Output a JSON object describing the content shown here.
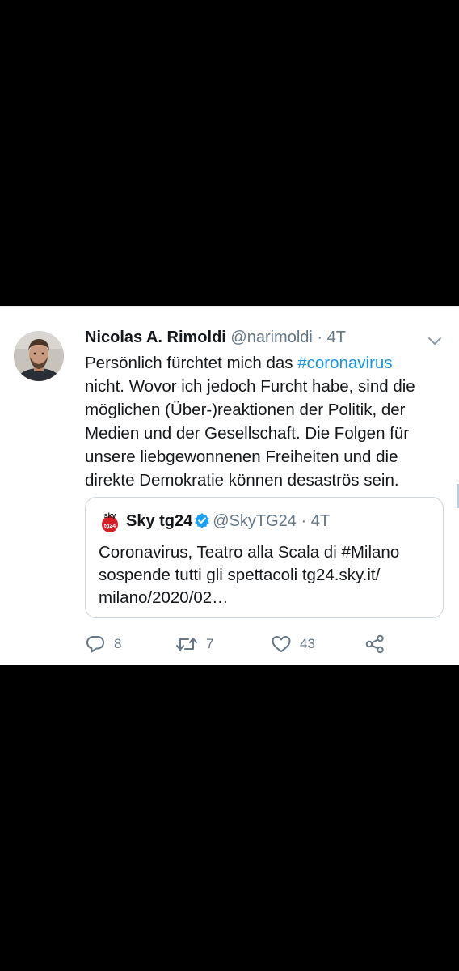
{
  "tweet": {
    "display_name": "Nicolas A. Rimoldi",
    "handle": "@narimoldi",
    "separator": " · ",
    "time": "4T",
    "text_lines": [
      [
        "Persönlich fürchtet mich das ",
        "#coronavirus"
      ],
      [
        "nicht. Wovor ich jedoch Furcht habe, sind die"
      ],
      [
        "möglichen (Über-)reaktionen der Politik, der"
      ],
      [
        "Medien und der Gesellschaft. Die Folgen für"
      ],
      [
        "unsere liebgewonnenen Freiheiten und die"
      ],
      [
        "direkte Demokratie können desaströs sein."
      ]
    ],
    "hashtag": "#coronavirus",
    "menu_icon": "chevron-down-icon"
  },
  "quote": {
    "logo_text_top": "sky",
    "logo_text_bottom": "tg24",
    "display_name": "Sky tg24",
    "verified": true,
    "handle": "@SkyTG24",
    "separator": " · ",
    "time": "4T",
    "text_lines": [
      "Coronavirus, Teatro alla Scala di #Milano",
      "sospende tutti gli spettacoli tg24.sky.it/",
      "milano/2020/02…"
    ]
  },
  "actions": {
    "reply": {
      "icon": "reply-icon",
      "count": "8"
    },
    "retweet": {
      "icon": "retweet-icon",
      "count": "7"
    },
    "like": {
      "icon": "heart-icon",
      "count": "43"
    },
    "share": {
      "icon": "share-icon"
    }
  },
  "colors": {
    "background": "#000000",
    "card": "#ffffff",
    "hashtag": "#1b95e0",
    "text": "#14171a",
    "secondary": "#657786",
    "sky_red": "#d51f26"
  }
}
